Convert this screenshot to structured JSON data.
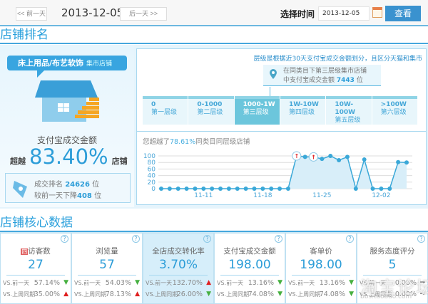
{
  "topbar": {
    "prev": "<< 前一天",
    "date": "2013-12-05",
    "next": "后一天 >>",
    "select_label": "选择时间",
    "date_value": "2013-12-05",
    "view": "查看"
  },
  "rank": {
    "title": "店铺排名",
    "category": "床上用品/布艺软饰",
    "market": "集市店铺",
    "metric_label": "支付宝成交金额",
    "exceed_prefix": "超越",
    "exceed_value": "83.40%",
    "exceed_suffix": "店铺",
    "rank_label": "成交排名",
    "rank_value": "24626",
    "rank_unit": "位",
    "change_prefix": "较前一天下降",
    "change_value": "408",
    "change_unit": "位"
  },
  "tier": {
    "note": "层级是根据近30天支付宝成交金额划分，且区分天猫和集市",
    "pin_line1": "在同类目下第三层级集市店铺",
    "pin_line2_prefix": "中支付宝成交金额",
    "pin_value": "7443",
    "pin_unit": "位",
    "tiers": [
      {
        "range": "0",
        "name": "第一层级"
      },
      {
        "range": "0-1000",
        "name": "第二层级"
      },
      {
        "range": "1000-1W",
        "name": "第三层级",
        "active": true
      },
      {
        "range": "1W-10W",
        "name": "第四层级"
      },
      {
        "range": "10W-100W",
        "name": "第五层级"
      },
      {
        "range": ">100W",
        "name": "第六层级"
      }
    ]
  },
  "chart_data": {
    "type": "area",
    "title_prefix": "您超越了",
    "title_value": "78.61%",
    "title_suffix": "同类目同层级店铺",
    "x": [
      "11-06",
      "11-07",
      "11-08",
      "11-09",
      "11-10",
      "11-11",
      "11-12",
      "11-13",
      "11-14",
      "11-15",
      "11-16",
      "11-17",
      "11-18",
      "11-19",
      "11-20",
      "11-21",
      "11-22",
      "11-23",
      "11-24",
      "11-25",
      "11-26",
      "11-27",
      "11-28",
      "11-29",
      "11-30",
      "12-01",
      "12-02",
      "12-03",
      "12-04",
      "12-05"
    ],
    "values": [
      0,
      0,
      0,
      0,
      0,
      0,
      0,
      0,
      0,
      0,
      0,
      0,
      0,
      0,
      0,
      0,
      100,
      97,
      97,
      91,
      100,
      87,
      97,
      0,
      89,
      0,
      0,
      0,
      81,
      80
    ],
    "up_markers": [
      "11-22",
      "11-24"
    ],
    "xticks": [
      "11-11",
      "11-18",
      "11-25",
      "12-02"
    ],
    "yticks": [
      0,
      20,
      40,
      60,
      80,
      100
    ],
    "ylim": [
      0,
      100
    ],
    "grid": true,
    "color": "#3aa8d8"
  },
  "core": {
    "title": "店铺核心数据",
    "vs_prev": "VS.前一天",
    "vs_week": "VS.上周同期",
    "cards": [
      {
        "name": "访客数",
        "badge": "四",
        "value": "27",
        "prev": "57.14%",
        "prev_dir": "down",
        "week": "35.00%",
        "week_dir": "up"
      },
      {
        "name": "浏览量",
        "value": "57",
        "prev": "54.03%",
        "prev_dir": "down",
        "week": "78.13%",
        "week_dir": "up"
      },
      {
        "name": "全店成交转化率",
        "value": "3.70%",
        "prev": "132.70%",
        "prev_dir": "up",
        "week": "26.00%",
        "week_dir": "down",
        "highlight": true
      },
      {
        "name": "支付宝成交金额",
        "value": "198.00",
        "prev": "13.16%",
        "prev_dir": "down",
        "week": "74.08%",
        "week_dir": "down"
      },
      {
        "name": "客单价",
        "value": "198.00",
        "prev": "13.16%",
        "prev_dir": "down",
        "week": "74.08%",
        "week_dir": "down"
      },
      {
        "name": "服务态度评分",
        "value": "5",
        "prev": "0.00%",
        "prev_dir": "flat",
        "week": "0.00%",
        "week_dir": "flat"
      }
    ]
  },
  "watermark": {
    "text": "淘宝论坛",
    "url": "bbs.taobao.com"
  },
  "colors": {
    "accent": "#2c9dd8",
    "up": "#e02020",
    "down": "#46b040"
  }
}
